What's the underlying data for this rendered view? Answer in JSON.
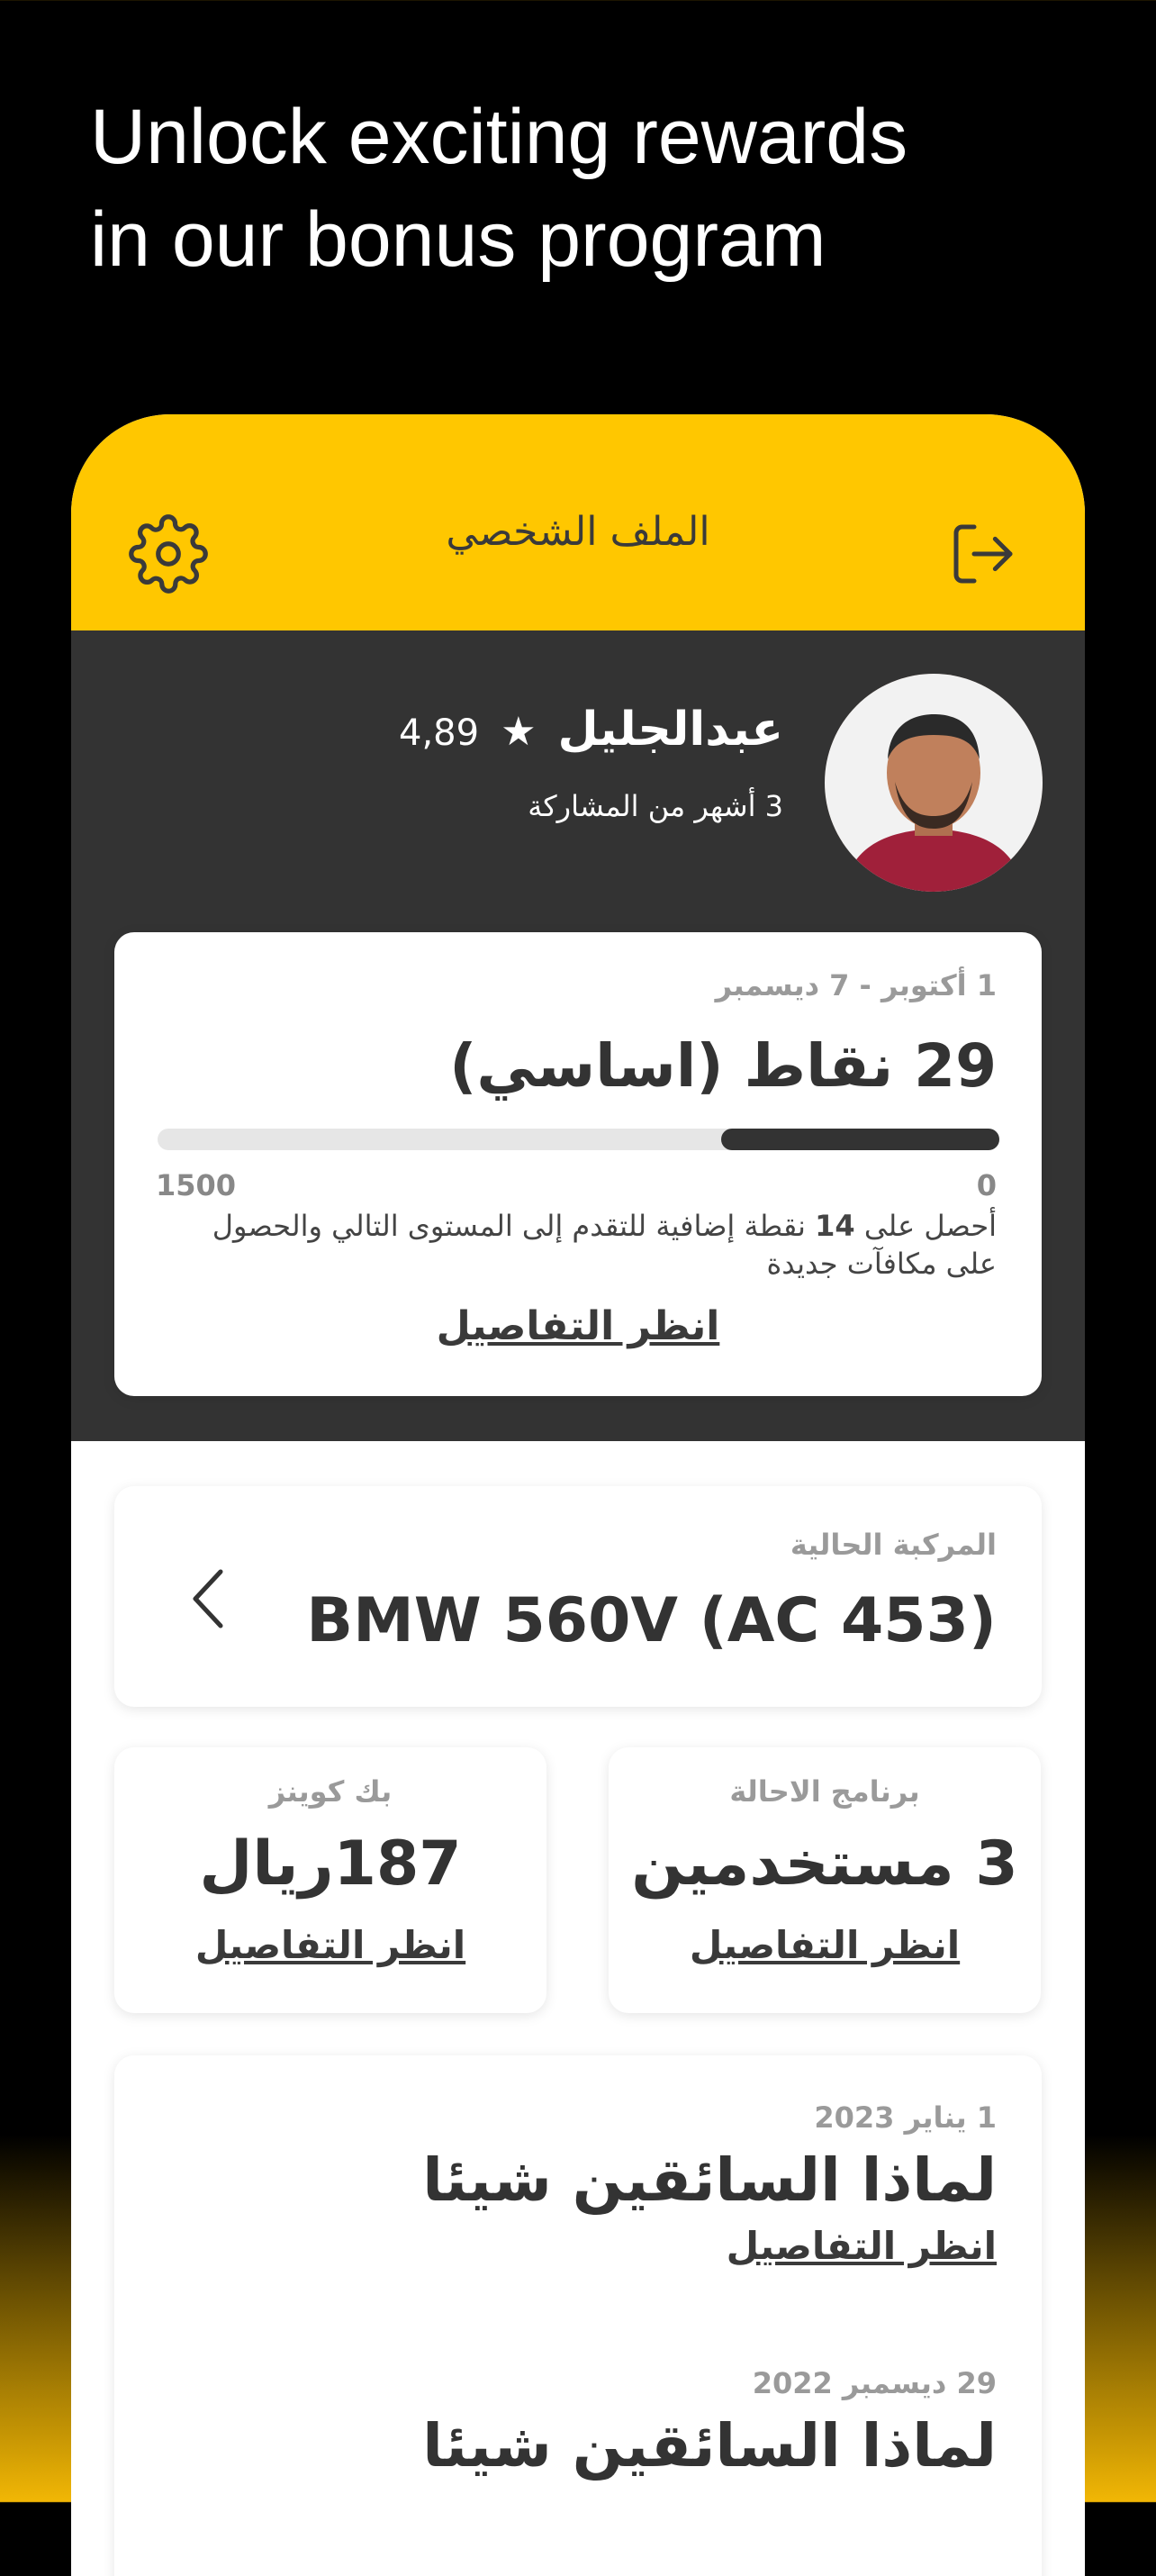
{
  "promo": {
    "line1": "Unlock exciting rewards",
    "line2": "in our bonus program"
  },
  "header": {
    "title": "الملف الشخصي",
    "settings_icon": "gear-icon",
    "logout_icon": "logout-icon"
  },
  "profile": {
    "name": "عبدالجليل",
    "rating": "4,89",
    "star": "★",
    "tenure": "3 أشهر من المشاركة"
  },
  "points_card": {
    "date_range": "1 أكتوبر - 7 ديسمبر",
    "points_text": "29 نقاط (اساسي)",
    "progress_min": "0",
    "progress_max": "1500",
    "progress_fraction": 0.33,
    "info_prefix": "أحصل على",
    "info_number": "14",
    "info_suffix": "نقطة إضافية للتقدم إلى المستوى التالي والحصول على مكافآت جديدة",
    "details_link": "انظر التفاصيل"
  },
  "vehicle": {
    "label": "المركبة الحالية",
    "name": "BMW 560V (AC 453)"
  },
  "referral": {
    "label": "برنامج الاحالة",
    "value": "3 مستخدمين",
    "link": "انظر التفاصيل"
  },
  "cashback": {
    "label": "بك كوينز",
    "value": "187ريال",
    "link": "انظر التفاصيل"
  },
  "news": [
    {
      "date": "1 يناير 2023",
      "title": "لماذا السائقين شيئا",
      "link": "انظر التفاصيل"
    },
    {
      "date": "29 ديسمبر 2022",
      "title": "لماذا السائقين شيئا",
      "link": ""
    }
  ],
  "colors": {
    "accent": "#ffc700",
    "dark_panel": "#333333"
  }
}
